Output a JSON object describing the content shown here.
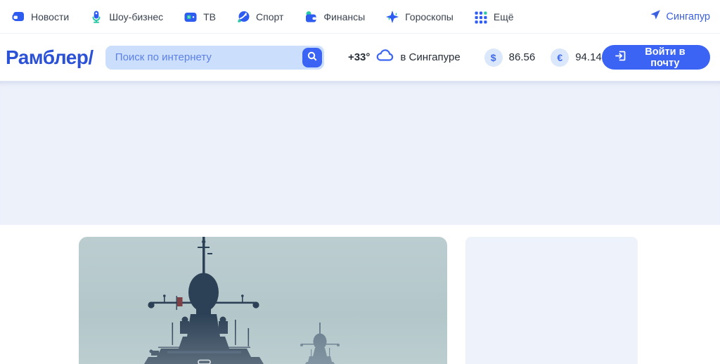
{
  "topnav": {
    "items": [
      {
        "label": "Новости",
        "icon": "news-icon"
      },
      {
        "label": "Шоу-бизнес",
        "icon": "microphone-icon"
      },
      {
        "label": "ТВ",
        "icon": "tv-icon"
      },
      {
        "label": "Спорт",
        "icon": "ball-icon"
      },
      {
        "label": "Финансы",
        "icon": "wallet-icon"
      },
      {
        "label": "Гороскопы",
        "icon": "star-icon"
      },
      {
        "label": "Ещё",
        "icon": "grid-icon"
      }
    ],
    "location": "Сингапур"
  },
  "header": {
    "logo": "Рамблер/",
    "search_placeholder": "Поиск по интернету",
    "weather": {
      "temp": "+33°",
      "location_text": "в Сингапуре"
    },
    "rates": [
      {
        "symbol": "$",
        "value": "86.56"
      },
      {
        "symbol": "€",
        "value": "94.14"
      }
    ],
    "login_button": "Войти в почту"
  },
  "colors": {
    "accent_blue": "#3c64f4",
    "logo_blue": "#2b51d6",
    "icon_blue": "#2f5cf0",
    "icon_teal": "#2cc8a5",
    "link_blue": "#3a5fe0",
    "search_bg": "#cbdffc",
    "search_placeholder": "#5d81e7",
    "coin_bg": "#dbe7fa",
    "text_dark": "#252d36",
    "ad_bg": "#edf1fa",
    "card_bg": "#eef2fb",
    "image_sky": "#b7c9cc",
    "ship_silhouette": "#2d4156"
  }
}
